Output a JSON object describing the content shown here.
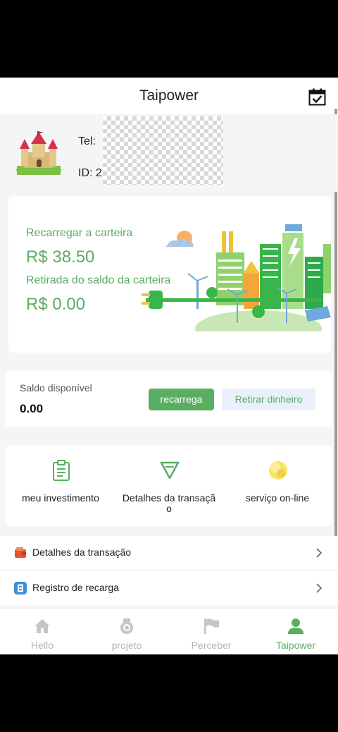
{
  "header": {
    "title": "Taipower"
  },
  "profile": {
    "tel_label": "Tel: ",
    "id_label": "ID: 2"
  },
  "wallet": {
    "recharge_label": "Recarregar a carteira",
    "recharge_value": "R$ 38.50",
    "withdraw_label": "Retirada do saldo da carteira",
    "withdraw_value": "R$ 0.00"
  },
  "balance": {
    "label": "Saldo disponível",
    "value": "0.00",
    "recharge_button": "recarrega",
    "withdraw_button": "Retirar dinheiro"
  },
  "shortcuts": [
    {
      "label": "meu investimento",
      "icon": "clipboard-icon"
    },
    {
      "label": "Detalhes da transaçã o",
      "icon": "triangle-icon"
    },
    {
      "label": "serviço on-line",
      "icon": "service-icon"
    }
  ],
  "menu": [
    {
      "label": "Detalhes da transação",
      "icon": "wallet-icon"
    },
    {
      "label": "Registro de recarga",
      "icon": "recharge-record-icon"
    }
  ],
  "tabs": [
    {
      "label": "Hello",
      "icon": "home-icon",
      "active": false
    },
    {
      "label": "projeto",
      "icon": "medal-icon",
      "active": false
    },
    {
      "label": "Perceber",
      "icon": "flag-icon",
      "active": false
    },
    {
      "label": "Taipower",
      "icon": "user-icon",
      "active": true
    }
  ],
  "colors": {
    "accent": "#5aae62",
    "withdraw_bg": "#e9f0fb",
    "inactive": "#b5b5b5"
  }
}
